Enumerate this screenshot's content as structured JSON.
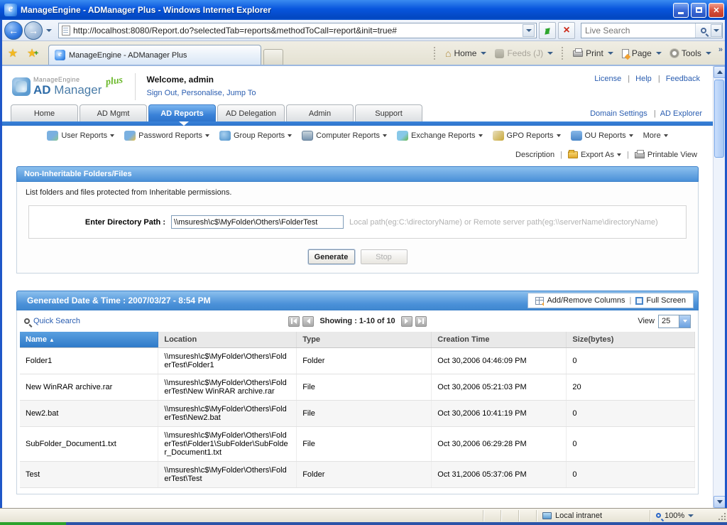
{
  "browser": {
    "title": "ManageEngine - ADManager Plus - Windows Internet Explorer",
    "url": "http://localhost:8080/Report.do?selectedTab=reports&methodToCall=report&init=true#",
    "search_placeholder": "Live Search",
    "tab_title": "ManageEngine - ADManager Plus",
    "toolbar": {
      "home": "Home",
      "feeds": "Feeds (J)",
      "print": "Print",
      "page": "Page",
      "tools": "Tools"
    },
    "status": {
      "zone": "Local intranet",
      "zoom": "100%"
    }
  },
  "app": {
    "header": {
      "logo_brand": "ManageEngine",
      "logo_product_bold": "AD",
      "logo_product": " Manager",
      "logo_plus": "plus",
      "welcome": "Welcome,  admin",
      "links": [
        "Sign Out",
        "Personalise",
        "Jump To"
      ],
      "top_links": [
        "License",
        "Help",
        "Feedback"
      ]
    },
    "tabs": [
      "Home",
      "AD Mgmt",
      "AD Reports",
      "AD Delegation",
      "Admin",
      "Support"
    ],
    "right_links": [
      "Domain Settings",
      "AD Explorer"
    ],
    "menu": [
      "User Reports",
      "Password Reports",
      "Group Reports",
      "Computer Reports",
      "Exchange Reports",
      "GPO Reports",
      "OU Reports",
      "More"
    ],
    "actions": {
      "description": "Description",
      "export_as": "Export As",
      "printable_view": "Printable View"
    },
    "report": {
      "title": "Non-Inheritable Folders/Files",
      "description": "List folders and files protected from Inheritable permissions.",
      "path_label": "Enter Directory Path :",
      "path_value": "\\\\msuresh\\c$\\MyFolder\\Others\\FolderTest",
      "path_hint": "Local path(eg:C:\\directoryName) or Remote server path(eg:\\\\serverName\\directoryName)",
      "generate": "Generate",
      "stop": "Stop"
    },
    "results": {
      "header": "Generated Date & Time : 2007/03/27 - 8:54 PM",
      "add_remove_columns": "Add/Remove Columns",
      "full_screen": "Full Screen",
      "quick_search": "Quick Search",
      "showing": "Showing : 1-10 of 10",
      "view_label": "View",
      "view_value": "25",
      "columns": [
        "Name",
        "Location",
        "Type",
        "Creation Time",
        "Size(bytes)"
      ],
      "sort_arrow": "▲",
      "rows": [
        {
          "name": "Folder1",
          "location": "\\\\msuresh\\c$\\MyFolder\\Others\\FolderTest\\Folder1",
          "type": "Folder",
          "created": "Oct 30,2006 04:46:09 PM",
          "size": "0"
        },
        {
          "name": "New WinRAR archive.rar",
          "location": "\\\\msuresh\\c$\\MyFolder\\Others\\FolderTest\\New WinRAR archive.rar",
          "type": "File",
          "created": "Oct 30,2006 05:21:03 PM",
          "size": "20"
        },
        {
          "name": "New2.bat",
          "location": "\\\\msuresh\\c$\\MyFolder\\Others\\FolderTest\\New2.bat",
          "type": "File",
          "created": "Oct 30,2006 10:41:19 PM",
          "size": "0"
        },
        {
          "name": "SubFolder_Document1.txt",
          "location": "\\\\msuresh\\c$\\MyFolder\\Others\\FolderTest\\Folder1\\SubFolder\\SubFolder_Document1.txt",
          "type": "File",
          "created": "Oct 30,2006 06:29:28 PM",
          "size": "0"
        },
        {
          "name": "Test",
          "location": "\\\\msuresh\\c$\\MyFolder\\Others\\FolderTest\\Test",
          "type": "Folder",
          "created": "Oct 31,2006 05:37:06 PM",
          "size": "0"
        }
      ]
    }
  }
}
